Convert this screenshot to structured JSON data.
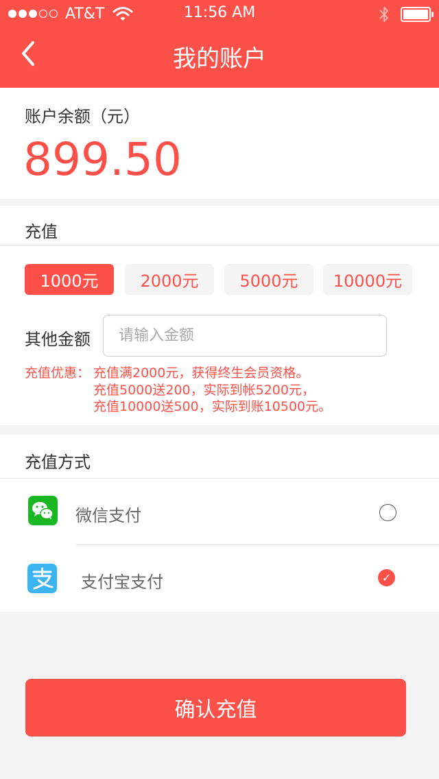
{
  "status_bar": {
    "carrier": "AT&T",
    "time": "11:56 AM",
    "signal_filled": 3,
    "signal_total": 5,
    "battery_level": 1.0
  },
  "header": {
    "title": "我的账户",
    "back_icon": "chevron-left-icon"
  },
  "balance": {
    "label": "账户余额（元）",
    "value": "899.50"
  },
  "recharge": {
    "section_title": "充值",
    "amounts": [
      {
        "label": "1000元",
        "selected": true
      },
      {
        "label": "2000元",
        "selected": false
      },
      {
        "label": "5000元",
        "selected": false
      },
      {
        "label": "10000元",
        "selected": false
      }
    ],
    "other_label": "其他金额",
    "other_placeholder": "请输入金额",
    "promo_prefix": "充值优惠：",
    "promo_lines": [
      "充值满2000元，获得终生会员资格。",
      "充值5000送200，实际到帐5200元，",
      "充值10000送500，实际到账10500元。"
    ]
  },
  "payment": {
    "section_title": "充值方式",
    "methods": [
      {
        "label": "微信支付",
        "icon": "wechat-icon",
        "selected": false
      },
      {
        "label": "支付宝支付",
        "icon": "alipay-icon",
        "selected": true
      }
    ]
  },
  "confirm_label": "确认充值",
  "colors": {
    "accent": "#fd5049",
    "wechat": "#1bb723",
    "alipay": "#3db4f2",
    "background": "#f4f4f4"
  }
}
